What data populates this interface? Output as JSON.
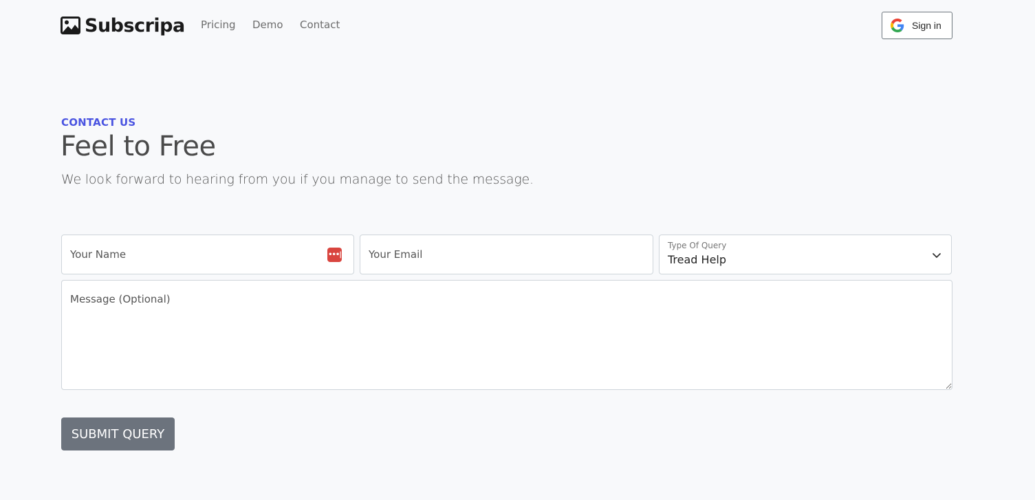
{
  "nav": {
    "brand": "Subscripa",
    "brand_icon": "image-icon",
    "links": [
      {
        "label": "Pricing"
      },
      {
        "label": "Demo"
      },
      {
        "label": "Contact"
      }
    ],
    "signin": {
      "label": "Sign in",
      "icon": "google-icon"
    }
  },
  "hero": {
    "eyebrow": "CONTACT US",
    "title": "Feel to Free",
    "subtitle": "We look forward to hearing from you if you manage to send the message."
  },
  "form": {
    "name": {
      "placeholder": "Your Name",
      "value": ""
    },
    "email": {
      "placeholder": "Your Email",
      "value": ""
    },
    "query_type": {
      "label": "Type Of Query",
      "selected": "Tread Help"
    },
    "message": {
      "placeholder": "Message (Optional)",
      "value": ""
    },
    "submit_label": "SUBMIT QUERY"
  },
  "colors": {
    "accent": "#4a54e1",
    "submit_bg": "#6c737d",
    "password_manager_icon": "#d9453f"
  }
}
